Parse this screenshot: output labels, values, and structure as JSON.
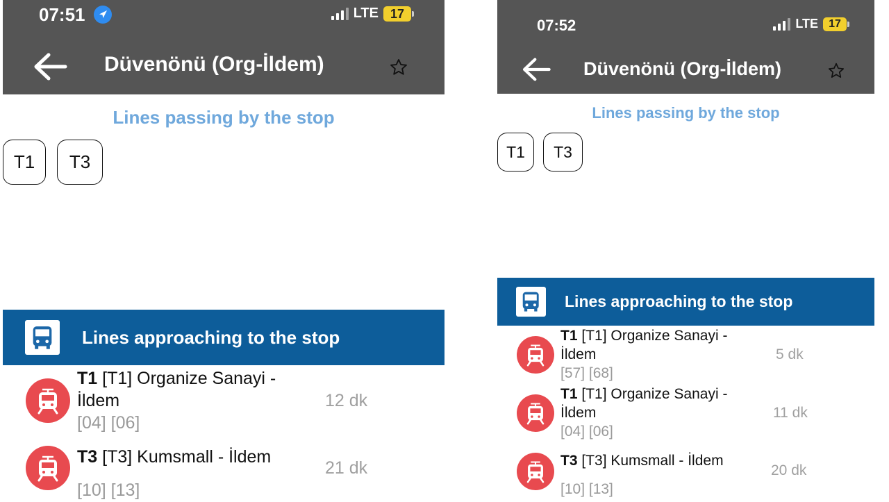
{
  "left": {
    "status": {
      "time": "07:51",
      "network": "LTE",
      "battery": "17"
    },
    "header": {
      "title": "Düvenönü (Org-İldem)"
    },
    "lines_section": {
      "title": "Lines passing by the stop",
      "chips": [
        "T1",
        "T3"
      ]
    },
    "approaching": {
      "title": "Lines approaching to the stop",
      "rows": [
        {
          "code": "T1",
          "name": "[T1] Organize Sanayi - İldem",
          "stops": "[04] [06]",
          "eta": "12 dk"
        },
        {
          "code": "T3",
          "name": "[T3] Kumsmall - İldem",
          "stops": "[10] [13]",
          "eta": "21 dk"
        }
      ]
    }
  },
  "right": {
    "status": {
      "time": "07:52",
      "network": "LTE",
      "battery": "17"
    },
    "header": {
      "title": "Düvenönü (Org-İldem)"
    },
    "lines_section": {
      "title": "Lines passing by the stop",
      "chips": [
        "T1",
        "T3"
      ]
    },
    "approaching": {
      "title": "Lines approaching to the stop",
      "rows": [
        {
          "code": "T1",
          "name": "[T1] Organize Sanayi - İldem",
          "stops": "[57] [68]",
          "eta": "5 dk"
        },
        {
          "code": "T1",
          "name": "[T1] Organize Sanayi - İldem",
          "stops": "[04] [06]",
          "eta": "11 dk"
        },
        {
          "code": "T3",
          "name": "[T3] Kumsmall - İldem",
          "stops": "[10] [13]",
          "eta": "20 dk"
        }
      ]
    }
  },
  "colors": {
    "appbar": "#555555",
    "section_title": "#6fa8dc",
    "approach_header": "#0d5d9a",
    "tram_icon": "#e84a4f",
    "battery": "#f2cf2d",
    "muted_text": "#9a9a9a"
  },
  "icons": {
    "back": "arrow-left-icon",
    "favorite": "star-outline-icon",
    "location": "location-arrow-icon",
    "bus": "bus-icon",
    "tram": "tram-icon"
  }
}
